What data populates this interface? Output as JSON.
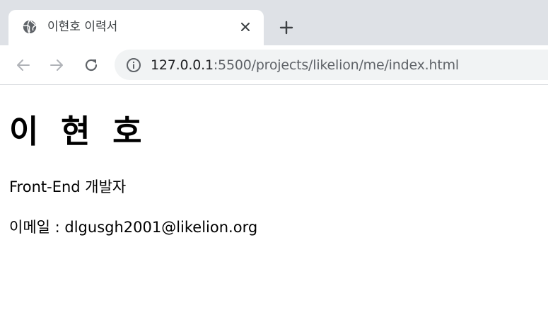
{
  "browser": {
    "tab": {
      "title": "이현호 이력서",
      "favicon": "globe-icon",
      "close_icon": "close-icon"
    },
    "new_tab_icon": "plus-icon",
    "nav": {
      "back_icon": "arrow-left-icon",
      "forward_icon": "arrow-right-icon",
      "reload_icon": "reload-icon"
    },
    "address_bar": {
      "info_icon": "info-icon",
      "url_host": "127.0.0.1",
      "url_path": ":5500/projects/likelion/me/index.html"
    },
    "colors": {
      "tabstrip_bg": "#dee1e6",
      "omnibox_bg": "#f1f3f4",
      "icon_color": "#5f6368",
      "disabled_icon_color": "#b0b3b8"
    }
  },
  "page": {
    "name": "이 현 호",
    "role": "Front-End 개발자",
    "email_line": "이메일 : dlgusgh2001@likelion.org"
  }
}
